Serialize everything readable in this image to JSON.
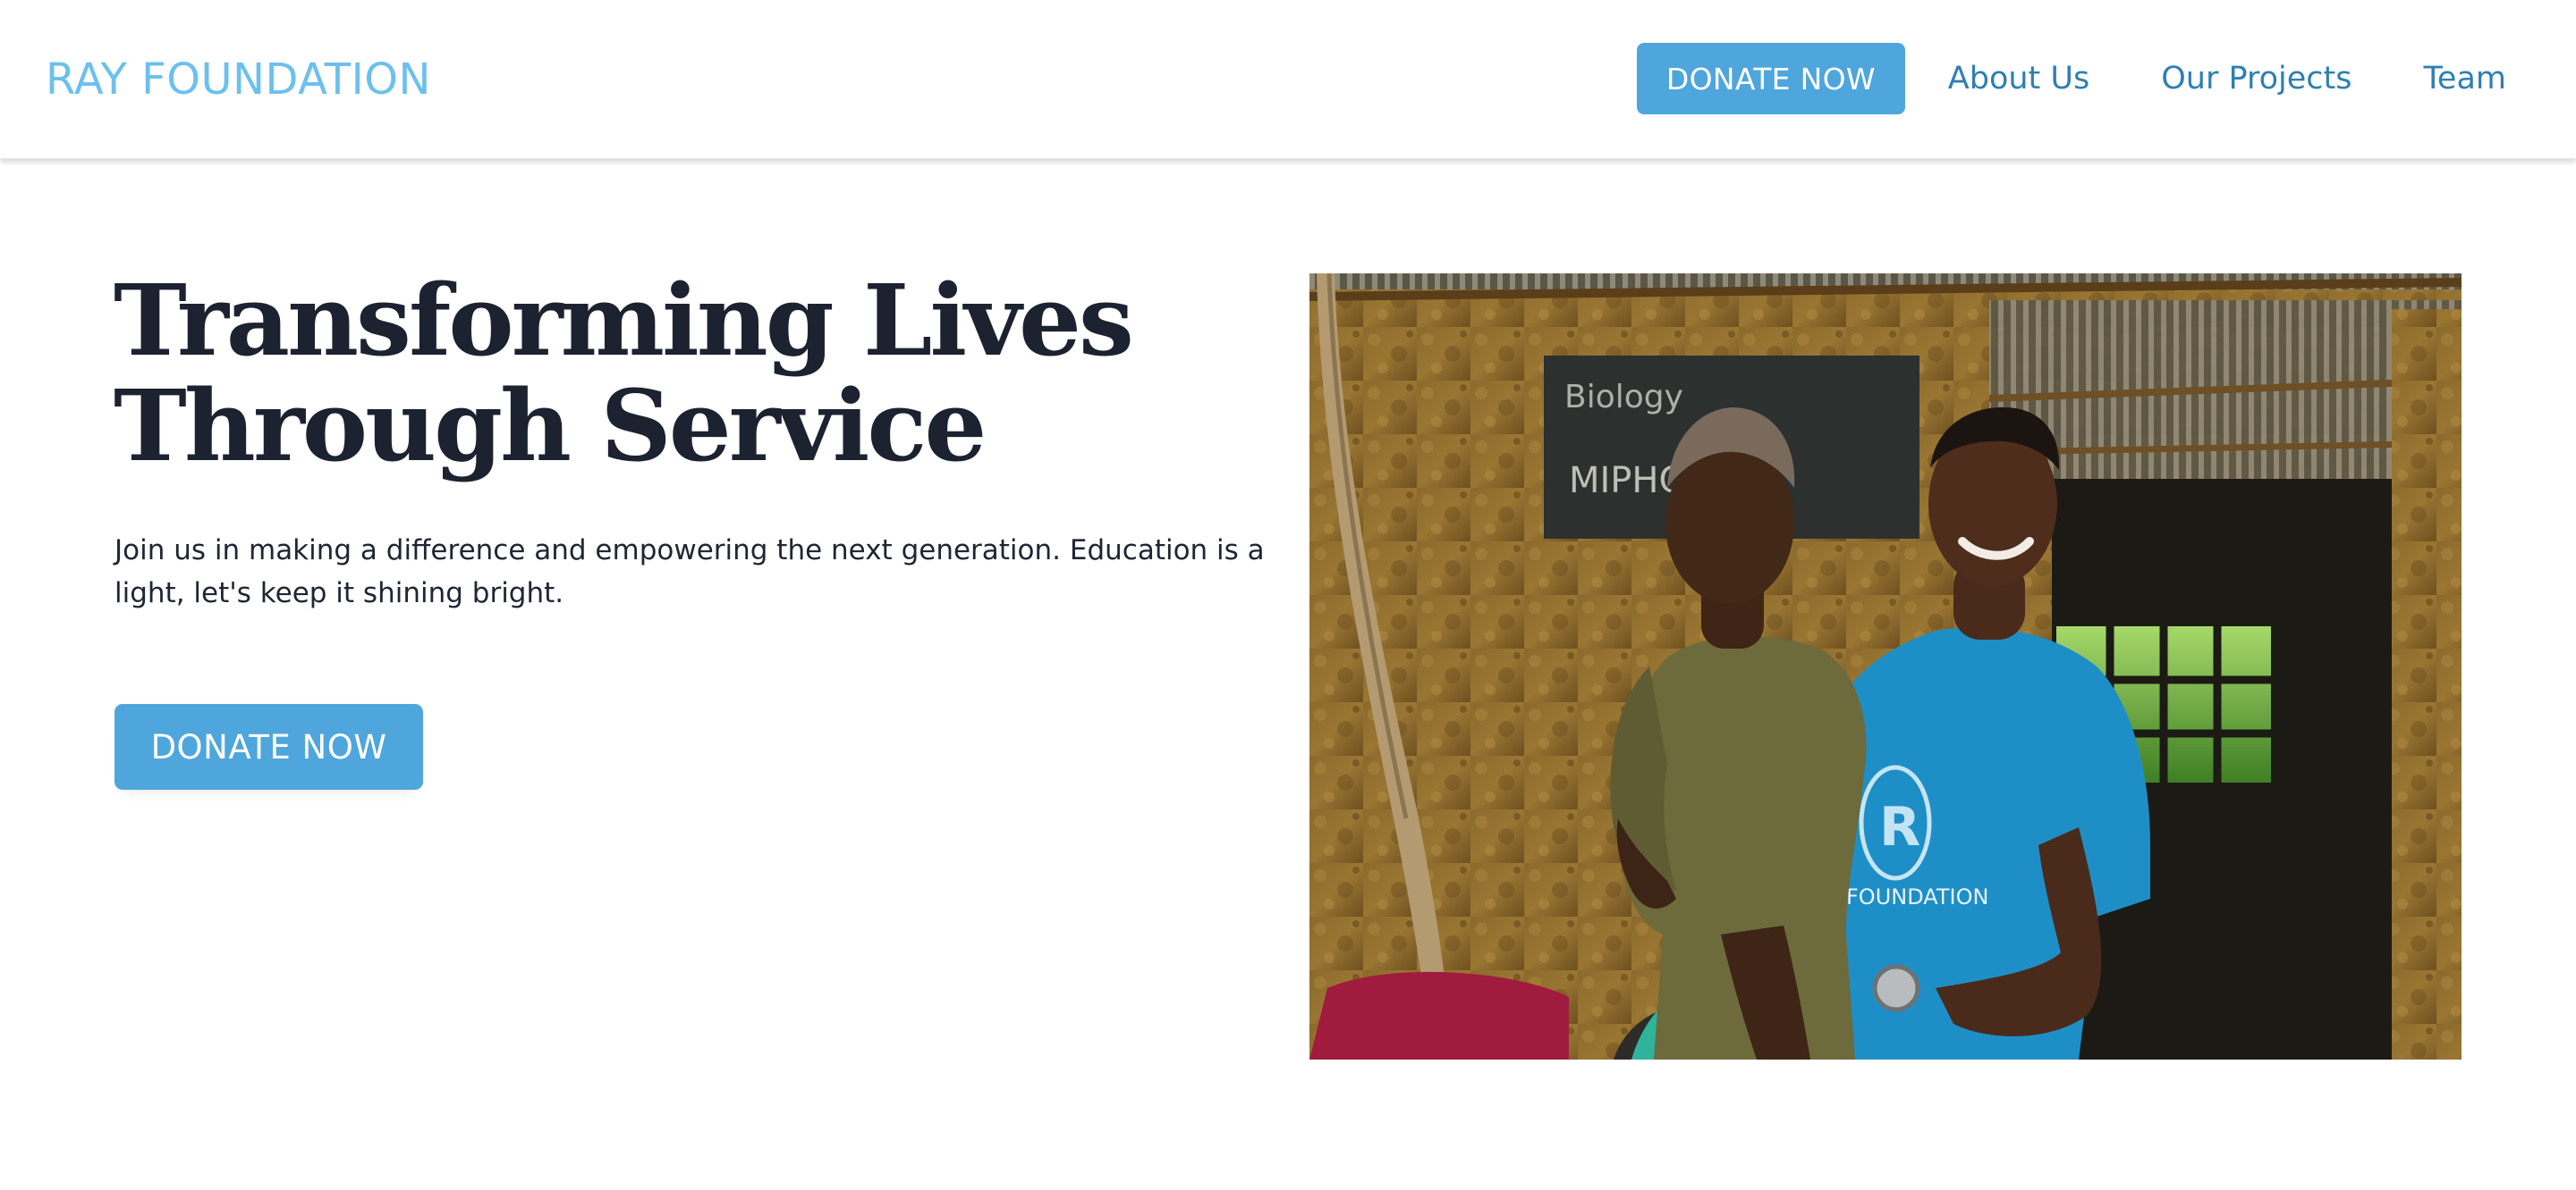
{
  "header": {
    "brand": "RAY FOUNDATION",
    "nav": {
      "donate_label": "DONATE NOW",
      "links": [
        "About Us",
        "Our Projects",
        "Team"
      ]
    }
  },
  "hero": {
    "title_line1": "Transforming Lives",
    "title_line2": "Through Service",
    "text": "Join us in making a difference and empowering the next generation. Education is a light, let's keep it shining bright.",
    "donate_label": "DONATE NOW"
  },
  "photo": {
    "chalkboard_text_1": "Biology",
    "chalkboard_text_2": "MIPHC",
    "shirt_text": "FOUNDATION",
    "shirt_logo_letter": "R"
  },
  "colors": {
    "brand_text": "#6cc0ee",
    "accent": "#4ea6dd",
    "nav_link": "#2f7fb2",
    "heading": "#1c2230",
    "body_text": "#1f2633"
  }
}
